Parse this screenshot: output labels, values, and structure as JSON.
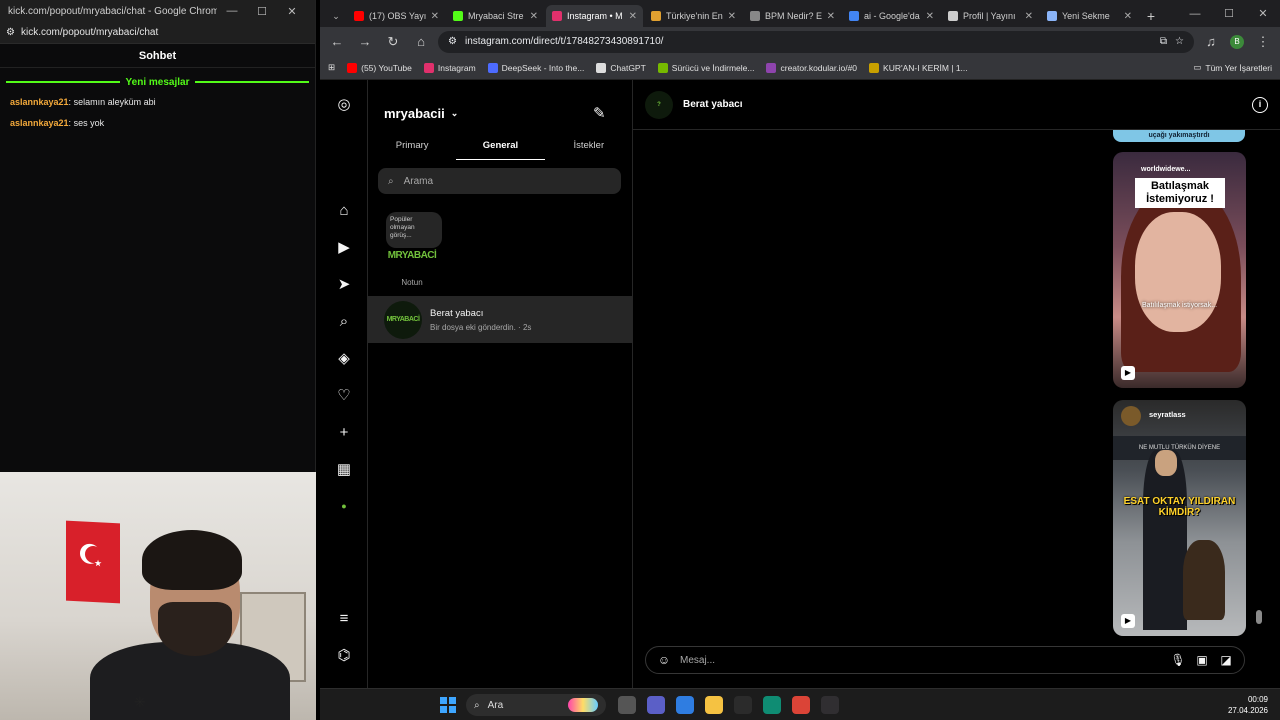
{
  "kick": {
    "window_title": "kick.com/popout/mryabaci/chat - Google Chrome",
    "url": "kick.com/popout/mryabaci/chat",
    "header": "Sohbet",
    "new_messages": "Yeni mesajlar",
    "messages": [
      {
        "user": "aslannkaya21",
        "text": "selamın aleyküm abi"
      },
      {
        "user": "aslannkaya21",
        "text": "ses yok"
      }
    ],
    "accent_color": "#53fc18"
  },
  "chrome": {
    "tabs": [
      {
        "title": "(17) OBS Yayı",
        "icon": "youtube-icon",
        "color": "#ff0000"
      },
      {
        "title": "Mryabaci Stre",
        "icon": "kick-icon",
        "color": "#53fc18"
      },
      {
        "title": "Instagram • M",
        "icon": "instagram-icon",
        "color": "#e1306c",
        "active": true
      },
      {
        "title": "Türkiye'nin En",
        "icon": "bird-icon",
        "color": "#e0a030"
      },
      {
        "title": "BPM Nedir? E",
        "icon": "bpm-icon",
        "color": "#888888"
      },
      {
        "title": "ai - Google'da",
        "icon": "google-icon",
        "color": "#4285f4"
      },
      {
        "title": "Profil | Yayını",
        "icon": "diamond-icon",
        "color": "#cccccc"
      },
      {
        "title": "Yeni Sekme",
        "icon": "chrome-icon",
        "color": "#8ab4f8"
      }
    ],
    "url": "instagram.com/direct/t/17848273430891710/",
    "bookmarks": [
      {
        "label": "(55) YouTube",
        "icon": "youtube-icon",
        "color": "#ff0000"
      },
      {
        "label": "Instagram",
        "icon": "instagram-icon",
        "color": "#e1306c"
      },
      {
        "label": "DeepSeek - Into the...",
        "icon": "deepseek-icon",
        "color": "#4d6bfe"
      },
      {
        "label": "ChatGPT",
        "icon": "chatgpt-icon",
        "color": "#dddddd"
      },
      {
        "label": "Sürücü ve İndirmele...",
        "icon": "driver-icon",
        "color": "#76b900"
      },
      {
        "label": "creator.kodular.io/#0",
        "icon": "kodular-icon",
        "color": "#8e44ad"
      },
      {
        "label": "KUR'AN-I KERİM | 1...",
        "icon": "book-icon",
        "color": "#c8a000"
      }
    ],
    "all_bookmarks": "Tüm Yer İşaretleri",
    "profile_initial": "B"
  },
  "instagram": {
    "username": "mryabacii",
    "tabs": [
      "Primary",
      "General",
      "İstekler"
    ],
    "active_tab": "General",
    "search_placeholder": "Arama",
    "note_bubble": "Popüler olmayan görüş...",
    "note_avatar_text": "MRYABACİ",
    "note_label": "Notun",
    "thread": {
      "name": "Berat yabacı",
      "preview": "Bir dosya eki gönderdin. · 2s",
      "avatar_text": "MRYABACİ"
    },
    "chat_title": "Berat yabacı",
    "reel_strip_text": "uçağı yakımaştırdı",
    "reel1": {
      "user": "worldwidewe...",
      "caption": "Batılaşmak İstemiyoruz !",
      "subtitle": "Batılılaşmak istiyorsak..."
    },
    "reel2": {
      "user": "seyratlass",
      "sign": "NE MUTLU TÜRKÜN DİYENE",
      "caption": "ESAT OKTAY YILDIRAN KİMDİR?"
    },
    "message_placeholder": "Mesaj..."
  },
  "taskbar": {
    "search_label": "Ara",
    "time": "00:09",
    "date": "27.04.2026",
    "apps": [
      {
        "icon": "task-view-icon",
        "color": "#555555"
      },
      {
        "icon": "teams-icon",
        "color": "#5b5fc7"
      },
      {
        "icon": "copilot-icon",
        "color": "#2f7de1"
      },
      {
        "icon": "file-explorer-icon",
        "color": "#f5c242"
      },
      {
        "icon": "store-icon",
        "color": "#2b2b2b"
      },
      {
        "icon": "edge-icon",
        "color": "#0f8c73"
      },
      {
        "icon": "chrome-icon",
        "color": "#db4437"
      },
      {
        "icon": "obs-icon",
        "color": "#302e31"
      }
    ]
  }
}
